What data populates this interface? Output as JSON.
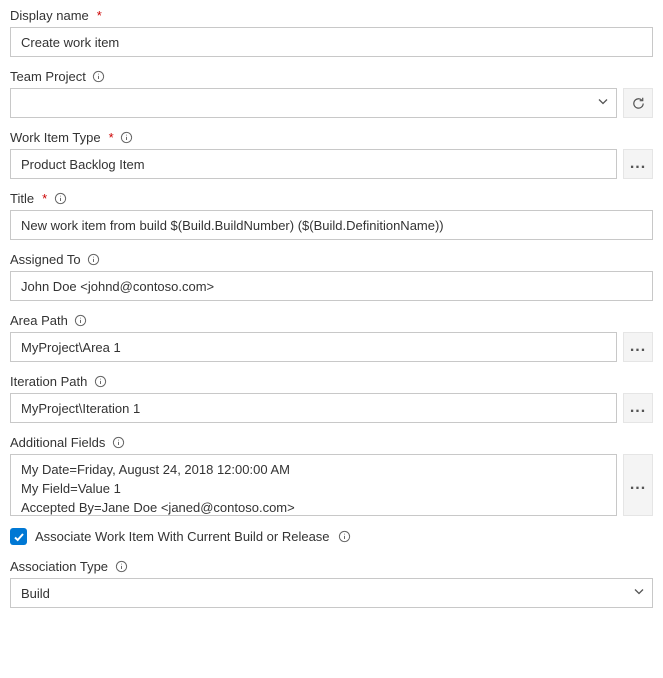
{
  "displayName": {
    "label": "Display name",
    "value": "Create work item",
    "required": true
  },
  "teamProject": {
    "label": "Team Project",
    "value": ""
  },
  "workItemType": {
    "label": "Work Item Type",
    "value": "Product Backlog Item",
    "required": true
  },
  "title": {
    "label": "Title",
    "value": "New work item from build $(Build.BuildNumber) ($(Build.DefinitionName))",
    "required": true
  },
  "assignedTo": {
    "label": "Assigned To",
    "value": "John Doe <johnd@contoso.com>"
  },
  "areaPath": {
    "label": "Area Path",
    "value": "MyProject\\Area 1"
  },
  "iterationPath": {
    "label": "Iteration Path",
    "value": "MyProject\\Iteration 1"
  },
  "additionalFields": {
    "label": "Additional Fields",
    "value": "My Date=Friday, August 24, 2018 12:00:00 AM\nMy Field=Value 1\nAccepted By=Jane Doe <janed@contoso.com>"
  },
  "associate": {
    "label": "Associate Work Item With Current Build or Release",
    "checked": true
  },
  "associationType": {
    "label": "Association Type",
    "value": "Build"
  },
  "glyphs": {
    "required": "*",
    "ellipsis": "..."
  }
}
